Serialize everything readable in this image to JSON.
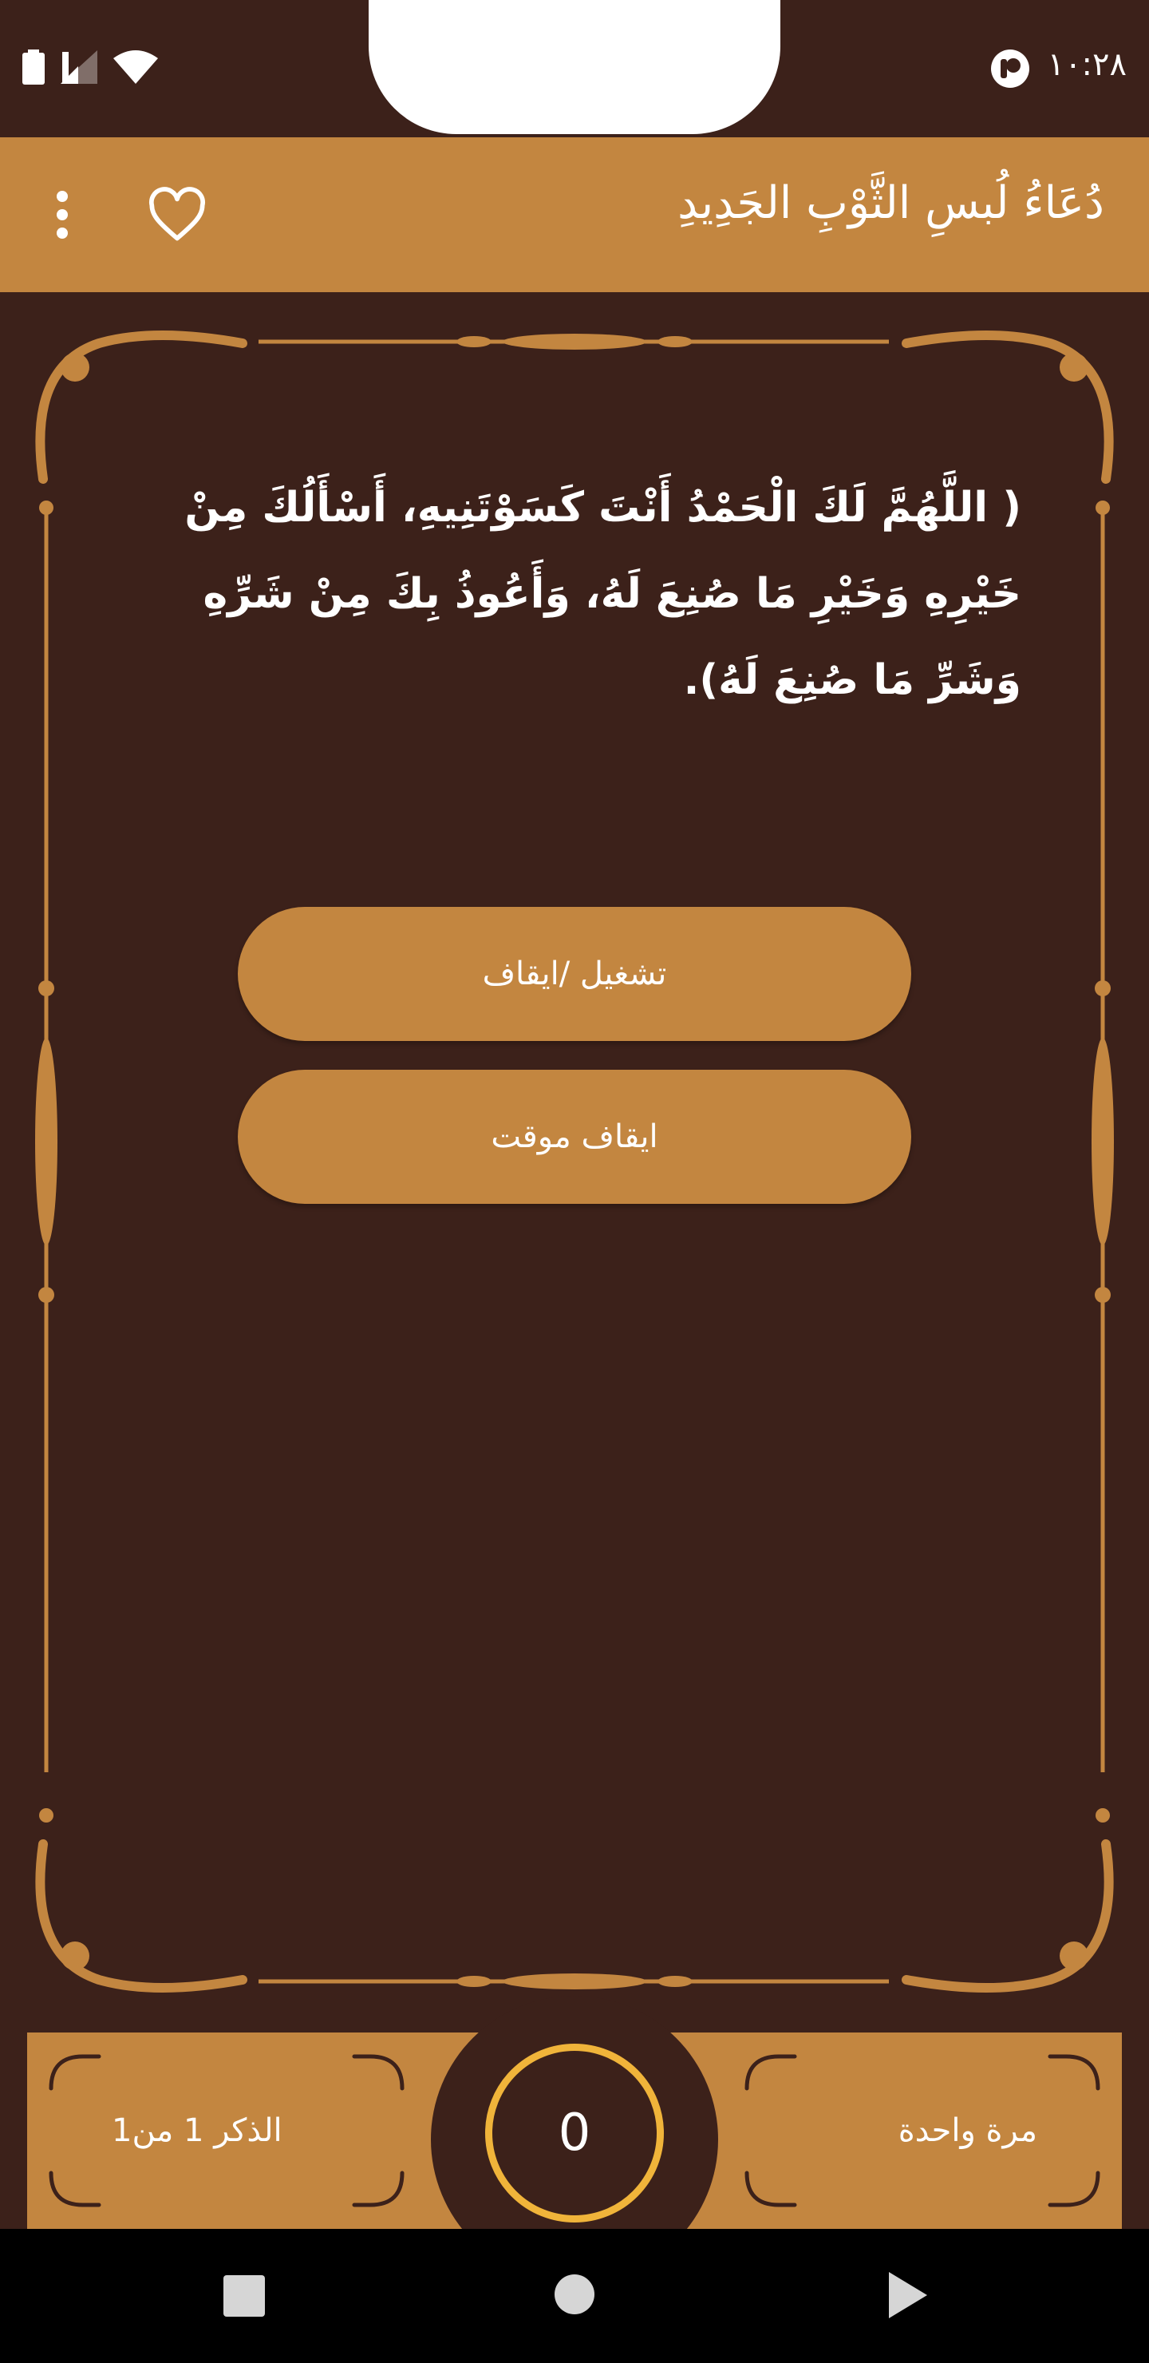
{
  "status_bar": {
    "time": "١٠:٢٨"
  },
  "app_bar": {
    "title": "دُعَاءُ لُبسِ الثَّوْبِ الجَدِيدِ"
  },
  "prayer": {
    "text": "( اللَّهُمَّ لَكَ الْحَمْدُ أَنْتَ كَسَوْتَنِيهِ، أَسْأَلُكَ مِنْ خَيْرِهِ وَخَيْرِ مَا صُنِعَ لَهُ، وَأَعُوذُ بِكَ مِنْ شَرِّهِ وَشَرِّ مَا صُنِعَ لَهُ)."
  },
  "buttons": {
    "play_pause": "تشغيل /ايقاف",
    "stop_timer": "ايقاف موقت"
  },
  "counter": {
    "value": "0",
    "repeat_label": "مرة واحدة",
    "dhikr_label": "الذكر 1 من1"
  },
  "colors": {
    "background": "#3c211a",
    "accent": "#c38640",
    "ring": "#f0b43a"
  },
  "icons": [
    "battery-icon",
    "signal-icon",
    "wifi-icon",
    "data-saver-icon",
    "heart-icon",
    "more-vert-icon",
    "nav-recents-icon",
    "nav-home-icon",
    "nav-back-icon"
  ]
}
